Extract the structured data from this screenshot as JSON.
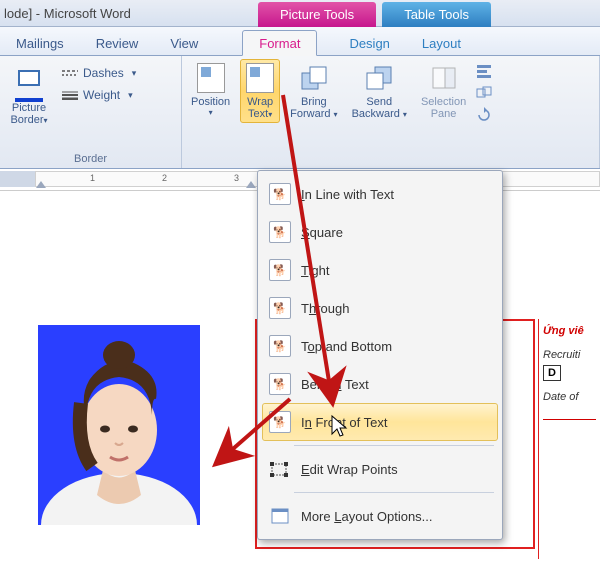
{
  "titlebar": {
    "text": "lode] - Microsoft Word"
  },
  "context_tools": {
    "picture": "Picture Tools",
    "table": "Table Tools"
  },
  "tabs": {
    "mailings": "Mailings",
    "review": "Review",
    "view": "View",
    "format": "Format",
    "design": "Design",
    "layout": "Layout"
  },
  "ribbon": {
    "picture_border": "Picture Border",
    "dashes": "Dashes",
    "weight": "Weight",
    "border_group": "Border",
    "position": "Position",
    "wrap_text": "Wrap Text",
    "bring_forward": "Bring Forward",
    "send_backward": "Send Backward",
    "selection_pane": "Selection Pane"
  },
  "menu": {
    "inline": "In Line with Text",
    "square": "Square",
    "tight": "Tight",
    "through": "Through",
    "topbottom": "Top and Bottom",
    "behind": "Behind Text",
    "infront": "In Front of Text",
    "editpoints": "Edit Wrap Points",
    "more": "More Layout Options..."
  },
  "side": {
    "heading": "Ứng viê",
    "recruit": "Recruiti",
    "dbox": "D",
    "dateof": "Date of"
  },
  "ruler": {
    "n1": "1",
    "n2": "2",
    "n3": "3"
  }
}
